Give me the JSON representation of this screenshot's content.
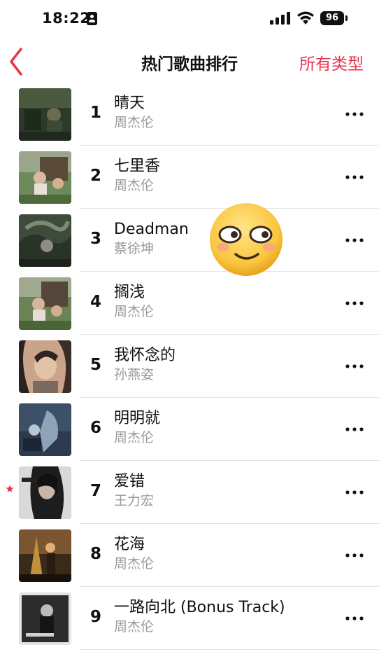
{
  "status_bar": {
    "time": "18:22",
    "battery": "96"
  },
  "nav": {
    "title": "热门歌曲排行",
    "filter_label": "所有类型",
    "accent_color": "#e8354d"
  },
  "songs": [
    {
      "rank": "1",
      "title": "晴天",
      "artist": "周杰伦",
      "starred": false
    },
    {
      "rank": "2",
      "title": "七里香",
      "artist": "周杰伦",
      "starred": false
    },
    {
      "rank": "3",
      "title": "Deadman",
      "artist": "蔡徐坤",
      "starred": false
    },
    {
      "rank": "4",
      "title": "搁浅",
      "artist": "周杰伦",
      "starred": false
    },
    {
      "rank": "5",
      "title": "我怀念的",
      "artist": "孙燕姿",
      "starred": false
    },
    {
      "rank": "6",
      "title": "明明就",
      "artist": "周杰伦",
      "starred": false
    },
    {
      "rank": "7",
      "title": "爱错",
      "artist": "王力宏",
      "starred": true
    },
    {
      "rank": "8",
      "title": "花海",
      "artist": "周杰伦",
      "starred": false
    },
    {
      "rank": "9",
      "title": "一路向北 (Bonus Track)",
      "artist": "周杰伦",
      "starred": false
    }
  ],
  "icons": {
    "back": "chevron-left-icon",
    "more": "more-horizontal-icon",
    "star": "star-icon",
    "sticker": "smiling-face-emoji"
  }
}
